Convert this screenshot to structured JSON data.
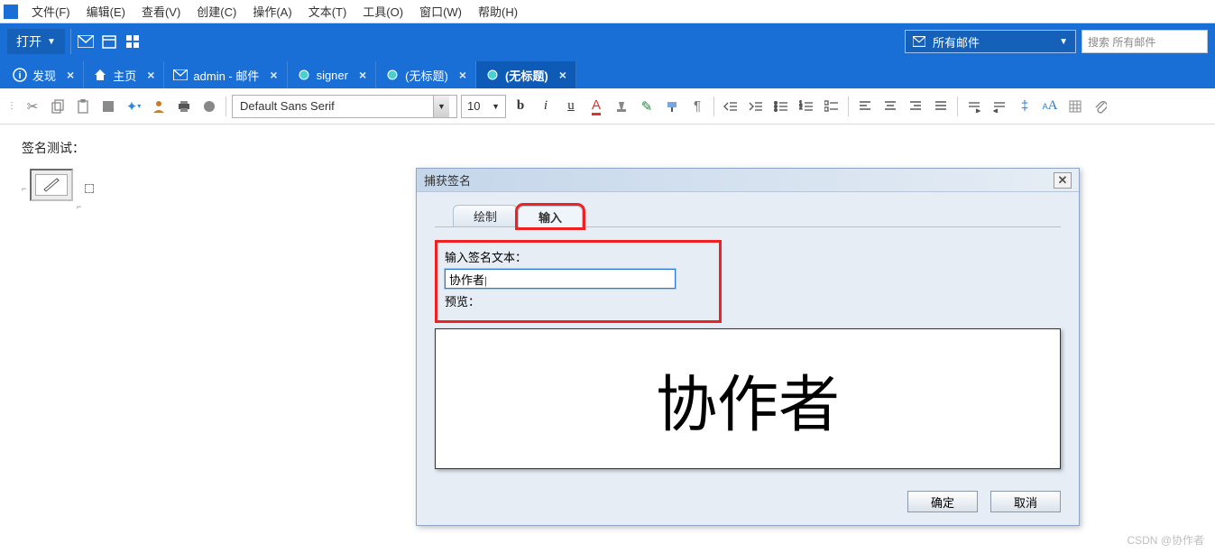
{
  "menu": {
    "items": [
      "文件(F)",
      "编辑(E)",
      "查看(V)",
      "创建(C)",
      "操作(A)",
      "文本(T)",
      "工具(O)",
      "窗口(W)",
      "帮助(H)"
    ]
  },
  "ribbon": {
    "open_label": "打开",
    "mail_selector": "所有邮件",
    "search_placeholder": "搜索 所有邮件"
  },
  "tabs": [
    {
      "icon": "info-icon",
      "label": "发现"
    },
    {
      "icon": "home-icon",
      "label": "主页"
    },
    {
      "icon": "mail-icon",
      "label": "admin - 邮件"
    },
    {
      "icon": "bug-icon",
      "label": "signer"
    },
    {
      "icon": "bug-icon",
      "label": "(无标题)"
    },
    {
      "icon": "bug-icon",
      "label": "(无标题)",
      "active": true
    }
  ],
  "format": {
    "font": "Default Sans Serif",
    "size": "10"
  },
  "doc": {
    "label": "签名测试："
  },
  "dialog": {
    "title": "捕获签名",
    "tab_draw": "绘制",
    "tab_input": "输入",
    "prompt": "输入签名文本：",
    "input_value": "协作者|",
    "preview_label": "预览：",
    "preview_text": "协作者",
    "ok": "确定",
    "cancel": "取消"
  },
  "watermark": "CSDN @协作者"
}
